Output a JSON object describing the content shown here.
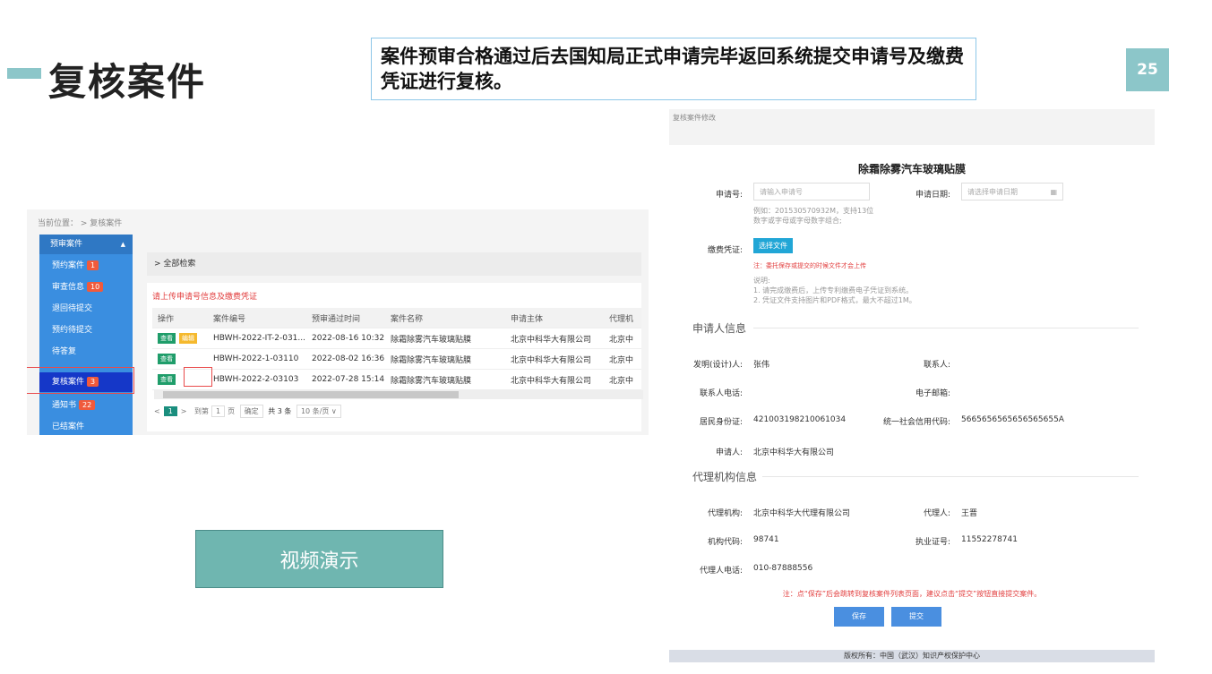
{
  "slide": {
    "title": "复核案件",
    "callout": "案件预审合格通过后去国知局正式申请完毕返回系统提交申请号及缴费凭证进行复核。",
    "page_number": "25",
    "video_button": "视频演示"
  },
  "list_screen": {
    "breadcrumb": "当前位置： >  复核案件",
    "sidebar": [
      {
        "label": "预审案件",
        "badge": ""
      },
      {
        "label": "预约案件",
        "badge": "1"
      },
      {
        "label": "审查信息",
        "badge": "10"
      },
      {
        "label": "退回待提交",
        "badge": ""
      },
      {
        "label": "预约待提交",
        "badge": ""
      },
      {
        "label": "待答复",
        "badge": ""
      },
      {
        "label": "复核案件",
        "badge": "3"
      },
      {
        "label": "通知书",
        "badge": "22"
      },
      {
        "label": "已结案件",
        "badge": ""
      }
    ],
    "search_toggle": "> 全部检索",
    "panel_title": "请上传申请号信息及缴费凭证",
    "columns": [
      "操作",
      "案件编号",
      "预审通过时间",
      "案件名称",
      "申请主体",
      "代理机"
    ],
    "view_label": "查看",
    "edit_label": "编辑",
    "rows": [
      {
        "id": "HBWH-2022-IT-2-031...",
        "time": "2022-08-16 10:32",
        "name": "除霜除雾汽车玻璃贴膜",
        "applicant": "北京中科华大有限公司",
        "agency": "北京中"
      },
      {
        "id": "HBWH-2022-1-03110",
        "time": "2022-08-02 16:36",
        "name": "除霜除雾汽车玻璃贴膜",
        "applicant": "北京中科华大有限公司",
        "agency": "北京中"
      },
      {
        "id": "HBWH-2022-2-03103",
        "time": "2022-07-28 15:14",
        "name": "除霜除雾汽车玻璃贴膜",
        "applicant": "北京中科华大有限公司",
        "agency": "北京中"
      }
    ],
    "pager": {
      "prev": "<",
      "current": "1",
      "next": ">",
      "goto": "到第",
      "page_input": "1",
      "page_unit": "页",
      "confirm": "确定",
      "total": "共 3 条",
      "page_size": "10 条/页 ∨"
    }
  },
  "form_screen": {
    "breadcrumb": "复核案件修改",
    "title": "除霜除雾汽车玻璃贴膜",
    "app_no_label": "申请号:",
    "app_no_placeholder": "请输入申请号",
    "app_date_label": "申请日期:",
    "app_date_placeholder": "请选择申请日期",
    "app_no_hint": "例如：201530570932M，支持13位数字或字母或字母数字组合;",
    "fee_label": "缴费凭证:",
    "file_button": "选择文件",
    "fee_warning": "注：委托保存或提交的时候文件才会上传",
    "fee_notes": "说明:\n1. 请完成缴费后，上传专利缴费电子凭证到系统。\n2. 凭证文件支持图片和PDF格式，最大不超过1M。",
    "applicant_section": "申请人信息",
    "inventor_label": "发明(设计)人:",
    "inventor_value": "张伟",
    "contact_label": "联系人:",
    "contact_value": "",
    "contact_phone_label": "联系人电话:",
    "contact_phone_value": "",
    "email_label": "电子邮箱:",
    "email_value": "",
    "id_label": "居民身份证:",
    "id_value": "421003198210061034",
    "credit_label": "统一社会信用代码:",
    "credit_value": "5665656565656565655A",
    "applicant_label": "申请人:",
    "applicant_value": "北京中科华大有限公司",
    "agency_section": "代理机构信息",
    "agency_label": "代理机构:",
    "agency_value": "北京中科华大代理有限公司",
    "agent_label": "代理人:",
    "agent_value": "王晋",
    "org_code_label": "机构代码:",
    "org_code_value": "98741",
    "license_label": "执业证号:",
    "license_value": "11552278741",
    "agent_phone_label": "代理人电话:",
    "agent_phone_value": "010-87888556",
    "save_note": "注：点“保存”后会跳转到复核案件列表页面，建议点击“提交”按钮直接提交案件。",
    "save_button": "保存",
    "submit_button": "提交",
    "footer": "版权所有：中国（武汉）知识产权保护中心"
  }
}
